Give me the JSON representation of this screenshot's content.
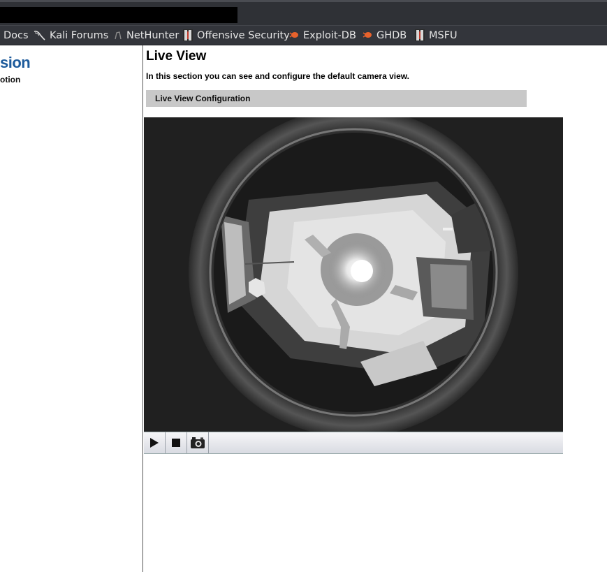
{
  "bookmarks": [
    {
      "label": "Docs",
      "icon": "none"
    },
    {
      "label": "Kali Forums",
      "icon": "kali-dragon-icon"
    },
    {
      "label": "NetHunter",
      "icon": "nethunter-icon"
    },
    {
      "label": "Offensive Security",
      "icon": "offensive-security-icon"
    },
    {
      "label": "Exploit-DB",
      "icon": "exploit-db-bug-icon"
    },
    {
      "label": "GHDB",
      "icon": "exploit-db-bug-icon"
    },
    {
      "label": "MSFU",
      "icon": "offensive-security-icon"
    }
  ],
  "sidebar": {
    "title": "sion",
    "subtitle": "otion"
  },
  "main": {
    "title": "Live View",
    "description": "In this section you can see and configure the default camera view.",
    "config_label": "Live View Configuration"
  },
  "player": {
    "controls": [
      "play-button",
      "stop-button",
      "snapshot-button"
    ]
  },
  "colors": {
    "sidebar_title": "#1c5a9b",
    "toolbar_bg": "#2f3136",
    "bookmark_bg": "#33353b",
    "config_bar": "#c8c8c8",
    "bug_orange": "#e8622c"
  }
}
